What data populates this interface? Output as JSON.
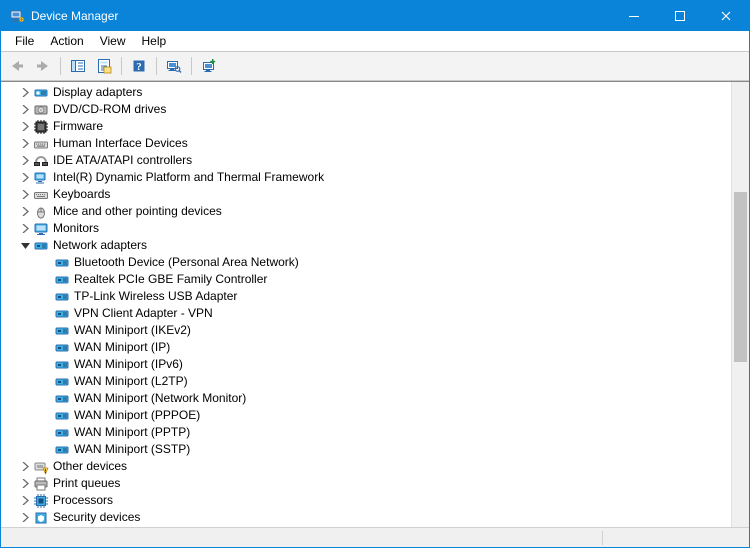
{
  "window": {
    "title": "Device Manager"
  },
  "menu": {
    "file": "File",
    "action": "Action",
    "view": "View",
    "help": "Help"
  },
  "tree": {
    "display_adapters": "Display adapters",
    "dvd_cdrom": "DVD/CD-ROM drives",
    "firmware": "Firmware",
    "hid": "Human Interface Devices",
    "ide": "IDE ATA/ATAPI controllers",
    "intel_dptf": "Intel(R) Dynamic Platform and Thermal Framework",
    "keyboards": "Keyboards",
    "mice": "Mice and other pointing devices",
    "monitors": "Monitors",
    "network_adapters": "Network adapters",
    "bt_pan": "Bluetooth Device (Personal Area Network)",
    "realtek_gbe": "Realtek PCIe GBE Family Controller",
    "tplink_usb": "TP-Link Wireless USB Adapter",
    "vpn_client": "VPN Client Adapter - VPN",
    "wan_ikev2": "WAN Miniport (IKEv2)",
    "wan_ip": "WAN Miniport (IP)",
    "wan_ipv6": "WAN Miniport (IPv6)",
    "wan_l2tp": "WAN Miniport (L2TP)",
    "wan_netmon": "WAN Miniport (Network Monitor)",
    "wan_pppoe": "WAN Miniport (PPPOE)",
    "wan_pptp": "WAN Miniport (PPTP)",
    "wan_sstp": "WAN Miniport (SSTP)",
    "other_devices": "Other devices",
    "print_queues": "Print queues",
    "processors": "Processors",
    "security_devices": "Security devices"
  }
}
